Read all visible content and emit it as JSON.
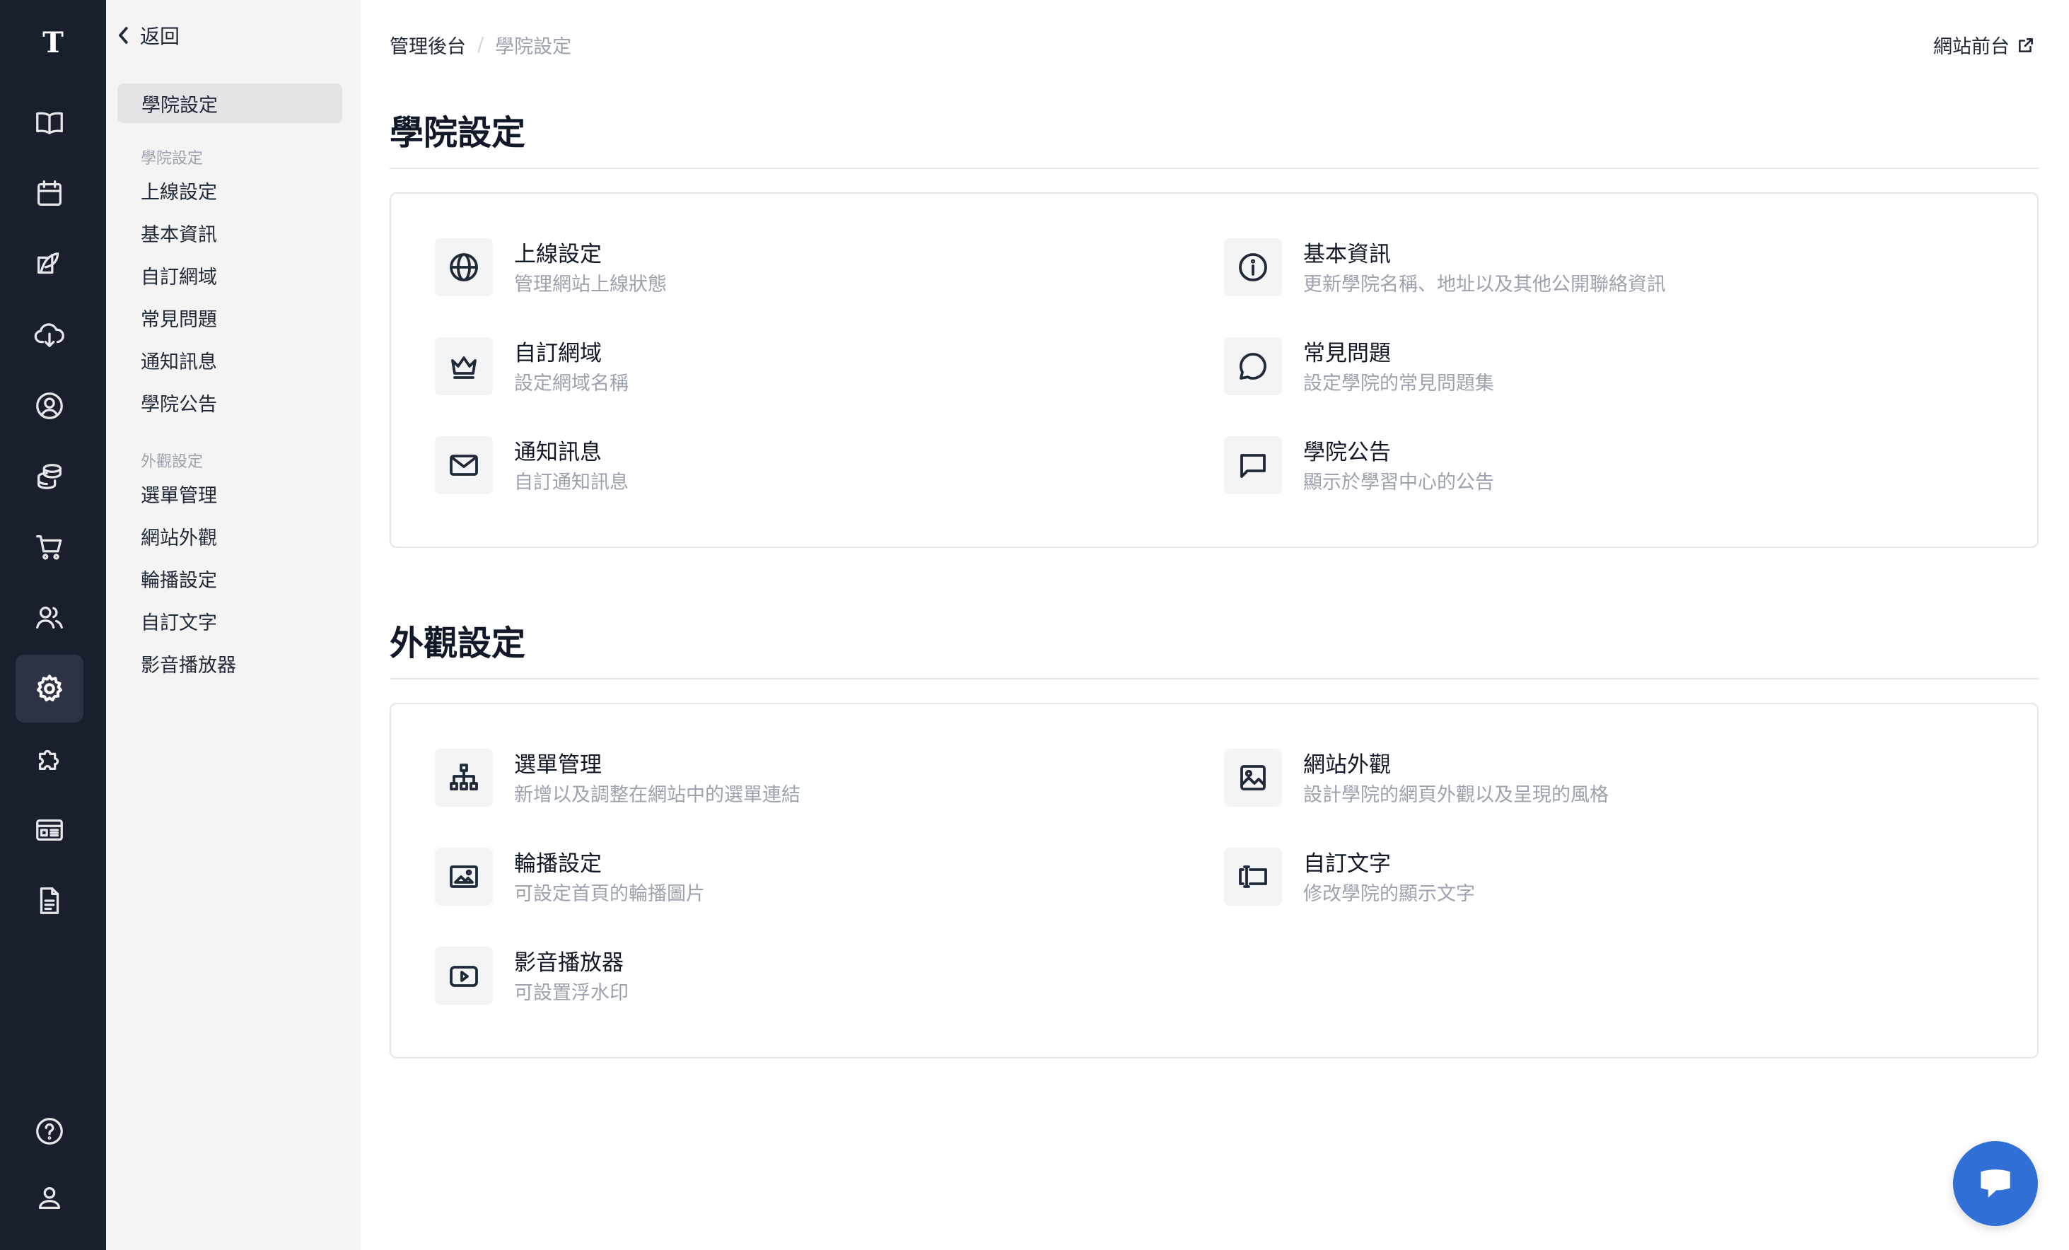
{
  "rail": {
    "logo": "T",
    "items": [
      {
        "name": "book-icon",
        "active": false
      },
      {
        "name": "calendar-icon",
        "active": false
      },
      {
        "name": "edit-icon",
        "active": false
      },
      {
        "name": "cloud-download-icon",
        "active": false
      },
      {
        "name": "user-circle-icon",
        "active": false
      },
      {
        "name": "coins-icon",
        "active": false
      },
      {
        "name": "cart-icon",
        "active": false
      },
      {
        "name": "users-icon",
        "active": false
      },
      {
        "name": "gear-icon",
        "active": true
      },
      {
        "name": "puzzle-icon",
        "active": false
      },
      {
        "name": "layout-icon",
        "active": false
      },
      {
        "name": "document-icon",
        "active": false
      }
    ],
    "bottom": [
      {
        "name": "help-icon"
      },
      {
        "name": "account-icon"
      }
    ]
  },
  "subnav": {
    "back_label": "返回",
    "active_label": "學院設定",
    "groups": [
      {
        "label": "學院設定",
        "items": [
          "上線設定",
          "基本資訊",
          "自訂網域",
          "常見問題",
          "通知訊息",
          "學院公告"
        ]
      },
      {
        "label": "外觀設定",
        "items": [
          "選單管理",
          "網站外觀",
          "輪播設定",
          "自訂文字",
          "影音播放器"
        ]
      }
    ]
  },
  "breadcrumb": {
    "root": "管理後台",
    "separator": "/",
    "current": "學院設定"
  },
  "front_link": "網站前台",
  "sections": [
    {
      "title": "學院設定",
      "items": [
        {
          "icon": "globe-icon",
          "title": "上線設定",
          "desc": "管理網站上線狀態"
        },
        {
          "icon": "info-icon",
          "title": "基本資訊",
          "desc": "更新學院名稱、地址以及其他公開聯絡資訊"
        },
        {
          "icon": "crown-icon",
          "title": "自訂網域",
          "desc": "設定網域名稱"
        },
        {
          "icon": "chat-bubble-icon",
          "title": "常見問題",
          "desc": "設定學院的常見問題集"
        },
        {
          "icon": "mail-icon",
          "title": "通知訊息",
          "desc": "自訂通知訊息"
        },
        {
          "icon": "message-square-icon",
          "title": "學院公告",
          "desc": "顯示於學習中心的公告"
        }
      ]
    },
    {
      "title": "外觀設定",
      "items": [
        {
          "icon": "sitemap-icon",
          "title": "選單管理",
          "desc": "新增以及調整在網站中的選單連結"
        },
        {
          "icon": "image-icon",
          "title": "網站外觀",
          "desc": "設計學院的網頁外觀以及呈現的風格"
        },
        {
          "icon": "slideshow-icon",
          "title": "輪播設定",
          "desc": "可設定首頁的輪播圖片"
        },
        {
          "icon": "text-cursor-icon",
          "title": "自訂文字",
          "desc": "修改學院的顯示文字"
        },
        {
          "icon": "video-play-icon",
          "title": "影音播放器",
          "desc": "可設置浮水印"
        }
      ]
    }
  ],
  "colors": {
    "rail_bg": "#1a1f2e",
    "subnav_bg": "#f4f4f5",
    "chat_button": "#2f6fd6"
  }
}
